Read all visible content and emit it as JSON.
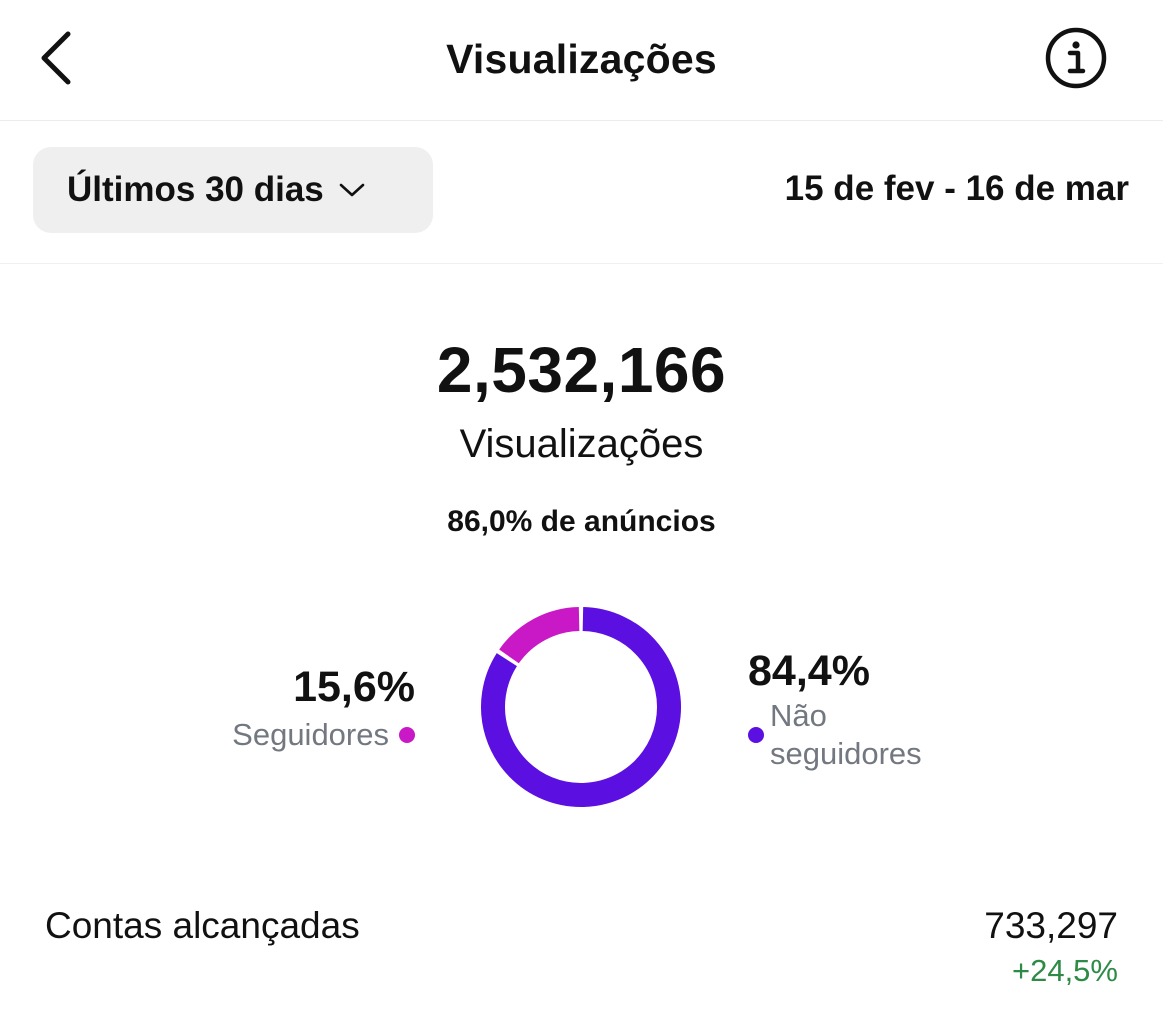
{
  "header": {
    "title": "Visualizações",
    "back_icon": "chevron-left-icon",
    "info_icon": "info-icon"
  },
  "filter": {
    "period_label": "Últimos 30 dias",
    "date_range": "15 de fev - 16 de mar"
  },
  "summary": {
    "total_value": "2,532,166",
    "total_label": "Visualizações",
    "ads_share": "86,0% de anúncios"
  },
  "breakdown": {
    "followers": {
      "percent_text": "15,6%",
      "label": "Seguidores",
      "value": 15.6,
      "color": "#c918c6"
    },
    "non_followers": {
      "percent_text": "84,4%",
      "label": "Não seguidores",
      "value": 84.4,
      "color": "#5b0fe0"
    }
  },
  "reach": {
    "label": "Contas alcançadas",
    "value": "733,297",
    "change": "+24,5%",
    "change_color": "#2e8b47"
  }
}
